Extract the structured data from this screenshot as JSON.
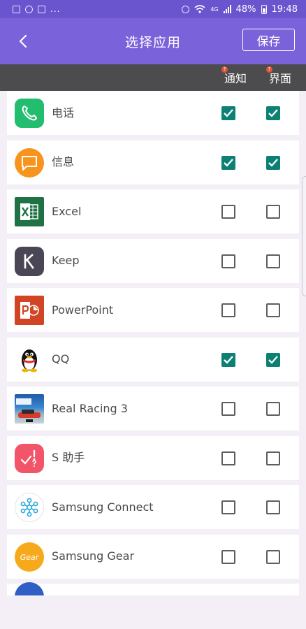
{
  "status_bar": {
    "dots": "...",
    "network": "4G",
    "battery": "48%",
    "time": "19:48"
  },
  "app_bar": {
    "title": "选择应用",
    "save_label": "保存"
  },
  "columns": {
    "notification": "通知",
    "interface": "界面",
    "badge": "?"
  },
  "colors": {
    "app_bar": "#7a62da",
    "status_bar": "#6a55cf",
    "header_bar": "#4c4c4e",
    "checkbox_checked": "#0d8074"
  },
  "apps": [
    {
      "name": "电话",
      "icon": "phone-icon",
      "notify": true,
      "ui": true
    },
    {
      "name": "信息",
      "icon": "message-icon",
      "notify": true,
      "ui": true
    },
    {
      "name": "Excel",
      "icon": "excel-icon",
      "notify": false,
      "ui": false
    },
    {
      "name": "Keep",
      "icon": "keep-icon",
      "notify": false,
      "ui": false
    },
    {
      "name": "PowerPoint",
      "icon": "powerpoint-icon",
      "notify": false,
      "ui": false
    },
    {
      "name": "QQ",
      "icon": "qq-penguin-icon",
      "notify": true,
      "ui": true
    },
    {
      "name": "Real Racing 3",
      "icon": "real-racing-icon",
      "notify": false,
      "ui": false
    },
    {
      "name": "S 助手",
      "icon": "s-assistant-icon",
      "notify": false,
      "ui": false
    },
    {
      "name": "Samsung Connect",
      "icon": "samsung-connect-icon",
      "notify": false,
      "ui": false
    },
    {
      "name": "Samsung Gear",
      "icon": "samsung-gear-icon",
      "notify": false,
      "ui": false
    }
  ]
}
